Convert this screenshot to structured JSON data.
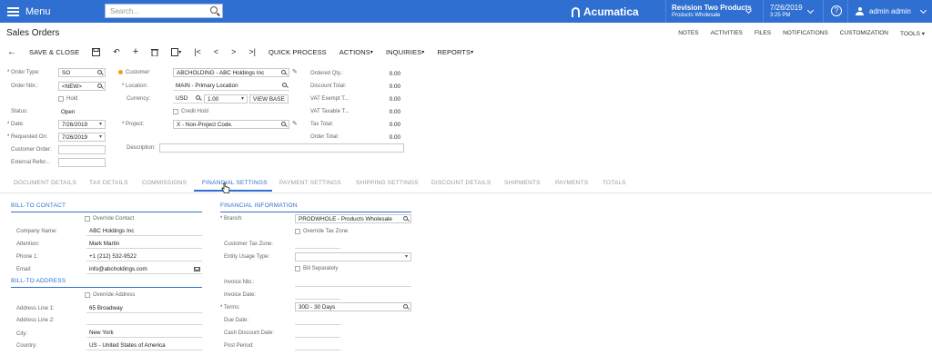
{
  "topbar": {
    "menu_label": "Menu",
    "search_placeholder": "Search...",
    "logo_text": "Acumatica",
    "branch_name": "Revision Two Products",
    "branch_sub": "Products Wholesale",
    "date": "7/26/2019",
    "time": "3:25 PM",
    "help": "?",
    "user": "admin admin"
  },
  "page": {
    "title": "Sales Orders",
    "right_links": [
      "NOTES",
      "ACTIVITIES",
      "FILES",
      "NOTIFICATIONS",
      "CUSTOMIZATION",
      "TOOLS"
    ]
  },
  "toolbar": {
    "save_close": "SAVE & CLOSE",
    "quick_process": "QUICK PROCESS",
    "actions": "ACTIONS",
    "inquiries": "INQUIRIES",
    "reports": "REPORTS"
  },
  "header": {
    "labels": {
      "order_type": "Order Type:",
      "order_nbr": "Order Nbr.:",
      "hold": "Hold",
      "status": "Status:",
      "date": "Date:",
      "requested_on": "Requested On:",
      "customer_order": "Customer Order:",
      "external_ref": "External Refer...",
      "customer": "Customer:",
      "location": "Location:",
      "currency": "Currency:",
      "credit_hold": "Credit Hold",
      "project": "Project:",
      "description": "Description:",
      "ordered_qty": "Ordered Qty.:",
      "discount_total": "Discount Total:",
      "vat_exempt": "VAT Exempt T...",
      "vat_taxable": "VAT Taxable T...",
      "tax_total": "Tax Total:",
      "order_total": "Order Total:"
    },
    "values": {
      "order_type": "SO",
      "order_nbr": "<NEW>",
      "status": "Open",
      "date": "7/26/2019",
      "requested_on": "7/26/2019",
      "customer": "ABCHOLDING - ABC Holdings Inc",
      "location": "MAIN - Primary Location",
      "currency": "USD",
      "rate": "1.00",
      "view_base": "VIEW BASE",
      "project": "X - Non-Project Code.",
      "ordered_qty": "0.00",
      "discount_total": "0.00",
      "vat_exempt": "0.00",
      "vat_taxable": "0.00",
      "tax_total": "0.00",
      "order_total": "0.00"
    }
  },
  "tabs": [
    "DOCUMENT DETAILS",
    "TAX DETAILS",
    "COMMISSIONS",
    "FINANCIAL SETTINGS",
    "PAYMENT SETTINGS",
    "SHIPPING SETTINGS",
    "DISCOUNT DETAILS",
    "SHIPMENTS",
    "PAYMENTS",
    "TOTALS"
  ],
  "bill_to_contact": {
    "title": "BILL-TO CONTACT",
    "override": "Override Contact",
    "labels": {
      "company": "Company Name:",
      "attention": "Attention:",
      "phone": "Phone 1:",
      "email": "Email:"
    },
    "values": {
      "company": "ABC Holdings Inc",
      "attention": "Mark Martin",
      "phone": "+1 (212) 532-9522",
      "email": "info@abcholdings.com"
    }
  },
  "bill_to_address": {
    "title": "BILL-TO ADDRESS",
    "override": "Override Address",
    "labels": {
      "line1": "Address Line 1:",
      "line2": "Address Line 2:",
      "city": "City:",
      "country": "Country:"
    },
    "values": {
      "line1": "65 Broadway",
      "city": "New York",
      "country": "US - United States of America"
    }
  },
  "financial_info": {
    "title": "FINANCIAL INFORMATION",
    "labels": {
      "branch": "Branch:",
      "override_tax_zone": "Override Tax Zone",
      "customer_tax_zone": "Customer Tax Zone:",
      "entity_usage_type": "Entity Usage Type:",
      "bill_separately": "Bill Separately",
      "invoice_nbr": "Invoice Nbr.:",
      "invoice_date": "Invoice Date:",
      "terms": "Terms:",
      "due_date": "Due Date:",
      "cash_discount_date": "Cash Discount Date:",
      "post_period": "Post Period:"
    },
    "values": {
      "branch": "PRODWHOLE - Products Wholesale",
      "terms": "30D - 30 Days"
    }
  }
}
